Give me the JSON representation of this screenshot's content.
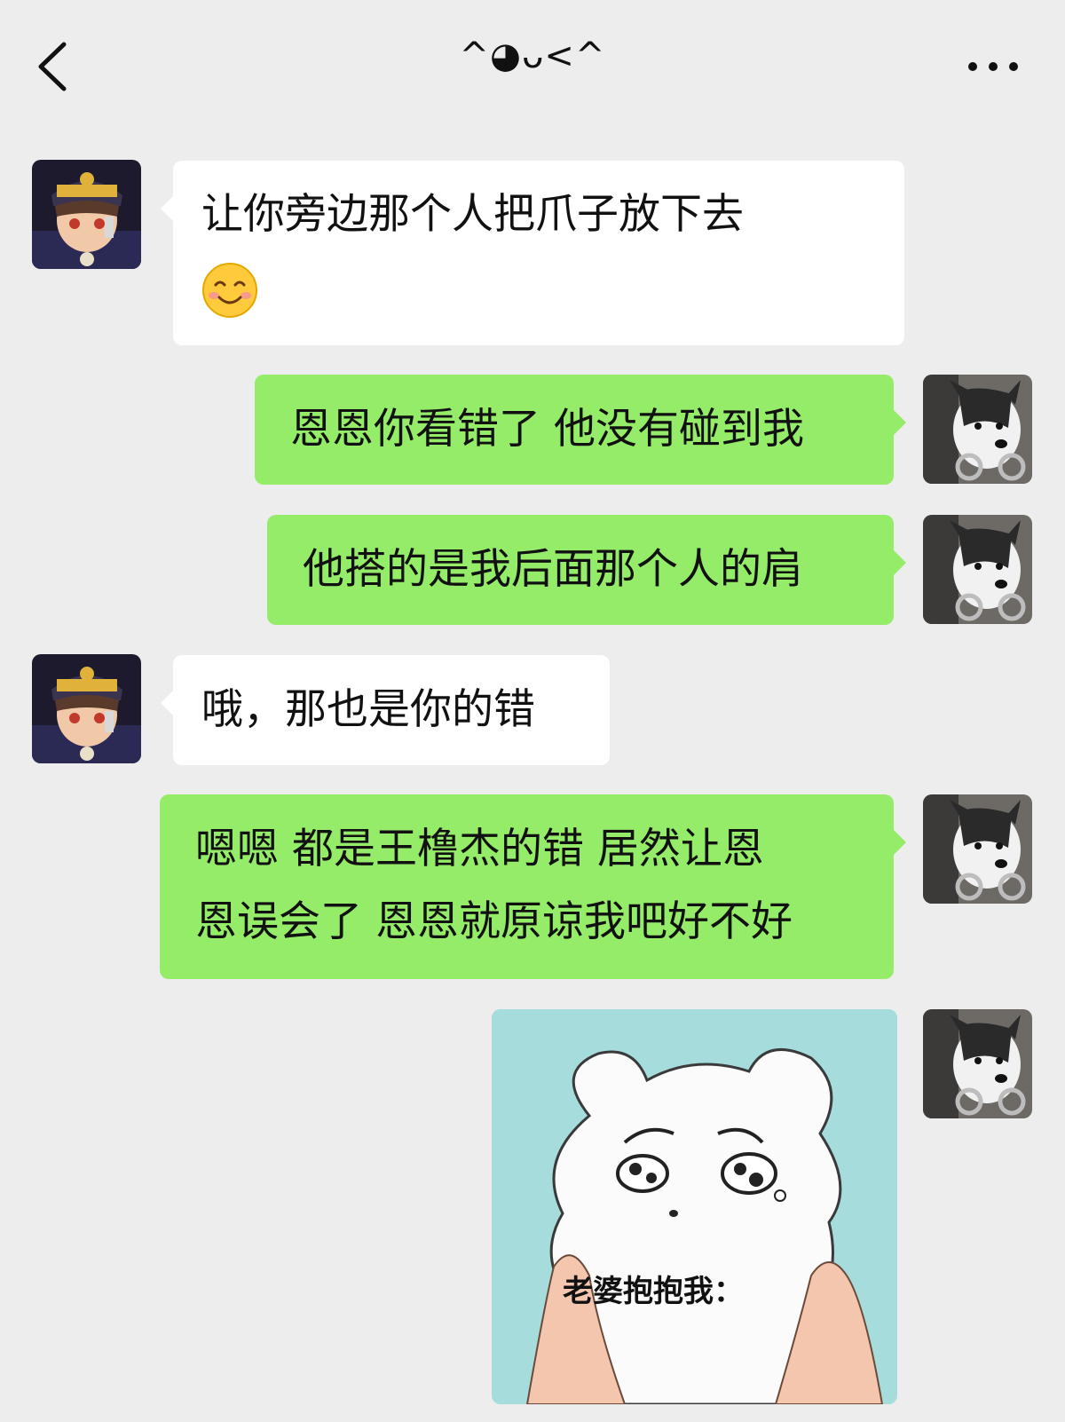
{
  "header": {
    "title": "^◕ᴗ<^",
    "back_icon": "chevron-left-icon",
    "more_icon": "more-horizontal-icon"
  },
  "messages": [
    {
      "side": "in",
      "text": "让你旁边那个人把爪子放下去",
      "emoji": "smiling-face-emoji"
    },
    {
      "side": "out",
      "text": "恩恩你看错了 他没有碰到我"
    },
    {
      "side": "out",
      "text": "他搭的是我后面那个人的肩"
    },
    {
      "side": "in",
      "text": "哦，那也是你的错"
    },
    {
      "side": "out",
      "line1": "嗯嗯 都是王橹杰的错 居然让恩",
      "line2": "恩误会了 恩恩就原谅我吧好不好"
    },
    {
      "side": "out",
      "type": "sticker",
      "caption": "老婆抱抱我："
    }
  ],
  "colors": {
    "background": "#ededed",
    "incoming_bubble": "#ffffff",
    "outgoing_bubble": "#95ec69"
  }
}
